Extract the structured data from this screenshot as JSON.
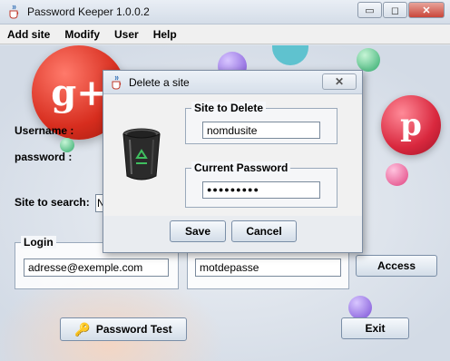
{
  "window": {
    "title": "Password Keeper 1.0.0.2",
    "min_glyph": "▭",
    "max_glyph": "◻",
    "close_glyph": "✕"
  },
  "menu": [
    "Add site",
    "Modify",
    "User",
    "Help"
  ],
  "background": {
    "gplus_text": "g+",
    "pinterest_text": "p"
  },
  "form": {
    "username_label": "Username :",
    "password_label": "password :",
    "site_search_label": "Site to search:",
    "site_search_value": "N",
    "login_group_title": "Login",
    "login_value": "adresse@exemple.com",
    "password_value": "motdepasse",
    "access_button": "Access",
    "password_test_button": "Password Test",
    "exit_button": "Exit"
  },
  "dialog": {
    "title": "Delete a site",
    "close_glyph": "✕",
    "site_group_title": "Site to Delete",
    "site_value": "nomdusite",
    "password_group_title": "Current Password",
    "password_value": "●●●●●●●●●",
    "save_button": "Save",
    "cancel_button": "Cancel"
  },
  "colors": {
    "gplus": "#d72d1e",
    "pinterest": "#d9283e",
    "accent_border": "#7a8ea7"
  },
  "icons": [
    "java-cup-icon",
    "trash-bin-icon",
    "recycle-icon",
    "key-icon",
    "close-icon",
    "minimize-icon",
    "maximize-icon"
  ]
}
